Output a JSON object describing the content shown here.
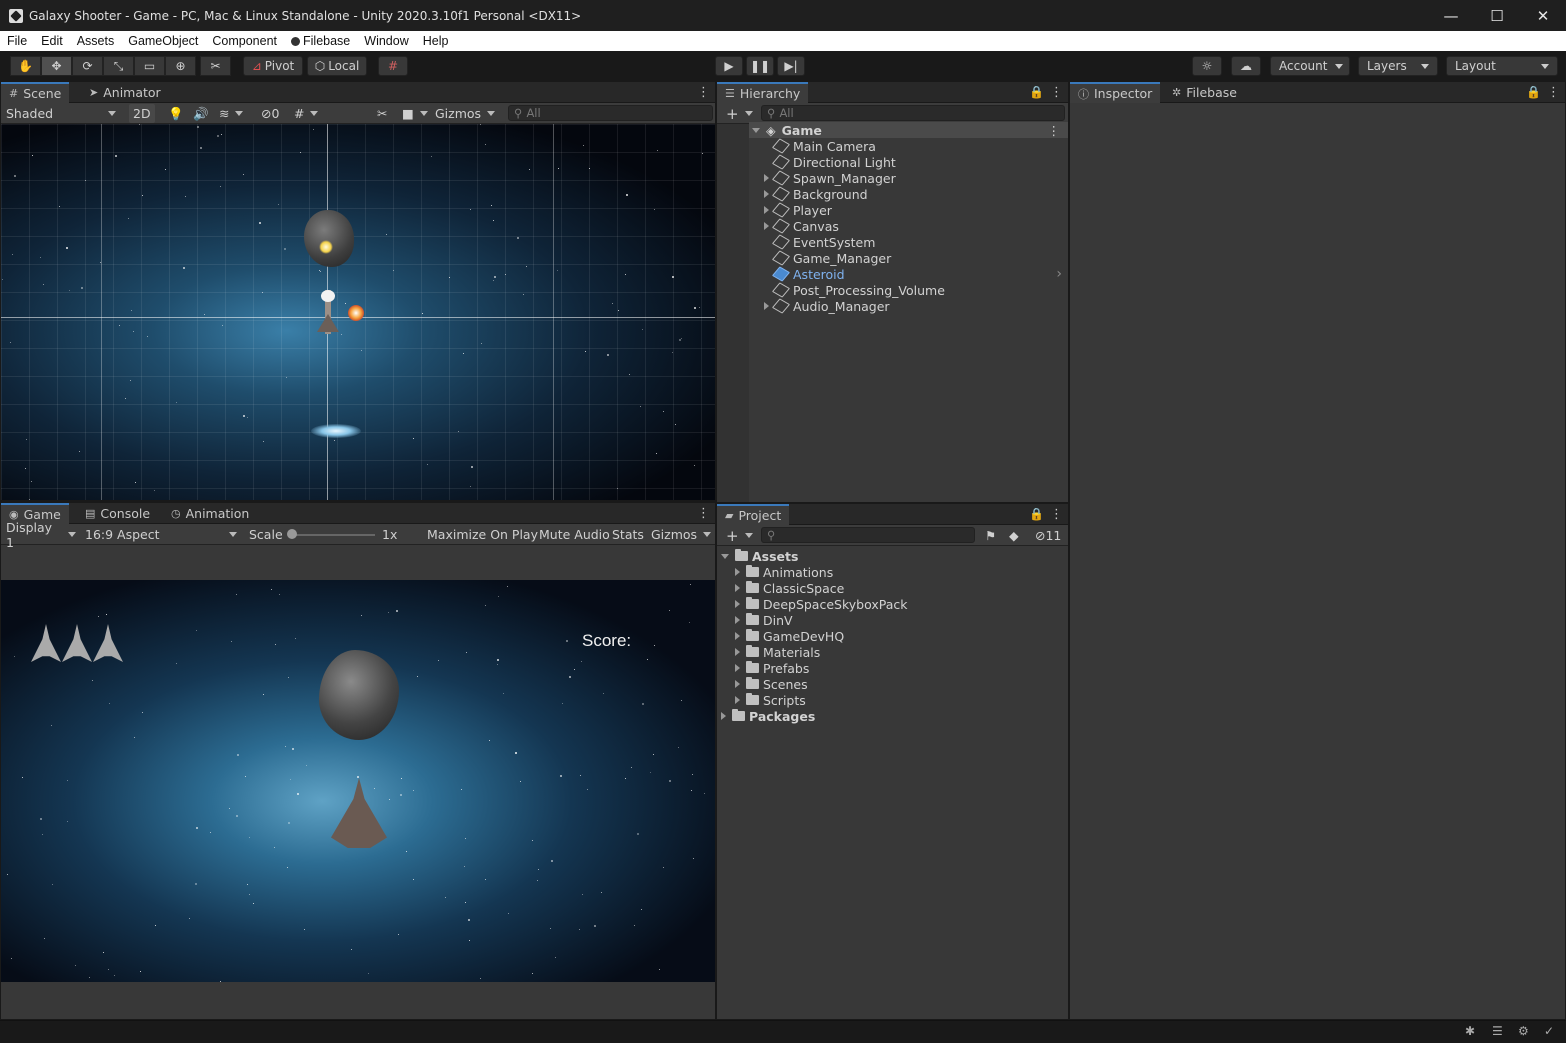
{
  "window": {
    "title": "Galaxy Shooter - Game - PC, Mac & Linux Standalone - Unity 2020.3.10f1 Personal <DX11>",
    "minimize": "—",
    "maximize": "☐",
    "close": "✕"
  },
  "menu": [
    "File",
    "Edit",
    "Assets",
    "GameObject",
    "Component",
    "Filebase",
    "Window",
    "Help"
  ],
  "toolbar": {
    "pivot": "Pivot",
    "local": "Local",
    "account": "Account",
    "layers": "Layers",
    "layout": "Layout"
  },
  "scene_panel": {
    "tabs": [
      "Scene",
      "Animator"
    ],
    "shading": "Shaded",
    "mode_2d": "2D",
    "hidden_count": "0",
    "gizmos": "Gizmos",
    "search_placeholder": "All"
  },
  "game_panel": {
    "tabs": [
      "Game",
      "Console",
      "Animation"
    ],
    "display": "Display 1",
    "aspect": "16:9 Aspect",
    "scale_label": "Scale",
    "scale_value": "1x",
    "maximize": "Maximize On Play",
    "mute": "Mute Audio",
    "stats": "Stats",
    "gizmos": "Gizmos",
    "score_label": "Score:"
  },
  "hierarchy": {
    "tab": "Hierarchy",
    "search_placeholder": "All",
    "root": "Game",
    "items": [
      {
        "label": "Main Camera",
        "expandable": false,
        "selected": false
      },
      {
        "label": "Directional Light",
        "expandable": false,
        "selected": false
      },
      {
        "label": "Spawn_Manager",
        "expandable": true,
        "selected": false
      },
      {
        "label": "Background",
        "expandable": true,
        "selected": false
      },
      {
        "label": "Player",
        "expandable": true,
        "selected": false
      },
      {
        "label": "Canvas",
        "expandable": true,
        "selected": false
      },
      {
        "label": "EventSystem",
        "expandable": false,
        "selected": false
      },
      {
        "label": "Game_Manager",
        "expandable": false,
        "selected": false
      },
      {
        "label": "Asteroid",
        "expandable": false,
        "selected": true
      },
      {
        "label": "Post_Processing_Volume",
        "expandable": false,
        "selected": false
      },
      {
        "label": "Audio_Manager",
        "expandable": true,
        "selected": false
      }
    ]
  },
  "project": {
    "tab": "Project",
    "hidden_count": "11",
    "root": "Assets",
    "folders": [
      "Animations",
      "ClassicSpace",
      "DeepSpaceSkyboxPack",
      "DinV",
      "GameDevHQ",
      "Materials",
      "Prefabs",
      "Scenes",
      "Scripts"
    ],
    "packages": "Packages"
  },
  "inspector": {
    "tabs": [
      "Inspector",
      "Filebase"
    ]
  },
  "colors": {
    "accent": "#3a79bb",
    "selected_text": "#7fb2ef",
    "panel_bg": "#383838"
  }
}
